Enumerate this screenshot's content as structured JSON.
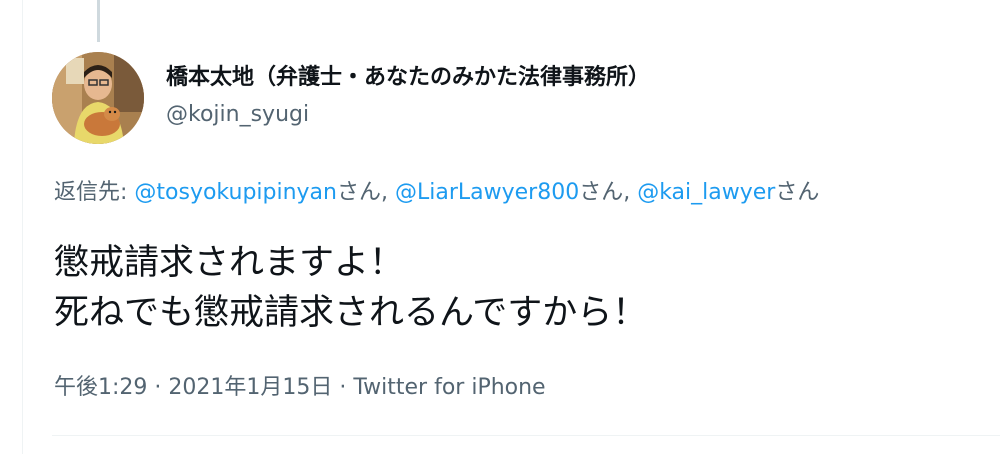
{
  "author": {
    "display_name": "橋本太地（弁護士・あなたのみかた法律事務所）",
    "handle": "@kojin_syugi"
  },
  "reply_context": {
    "prefix": "返信先: ",
    "mentions": [
      {
        "handle": "@tosyokupipinyan",
        "suffix": "さん, "
      },
      {
        "handle": "@LiarLawyer800",
        "suffix": "さん, "
      },
      {
        "handle": "@kai_lawyer",
        "suffix": "さん"
      }
    ]
  },
  "tweet": {
    "lines": [
      "懲戒請求されますよ！",
      "死ねでも懲戒請求されるんですから！"
    ]
  },
  "meta": {
    "time": "午後1:29",
    "separator1": " · ",
    "date": "2021年1月15日",
    "separator2": " · ",
    "source": "Twitter for iPhone"
  },
  "colors": {
    "text": "#0f1419",
    "secondary": "#536471",
    "link": "#1d9bf0",
    "border": "#eff3f4",
    "thread_line": "#cfd9de"
  }
}
